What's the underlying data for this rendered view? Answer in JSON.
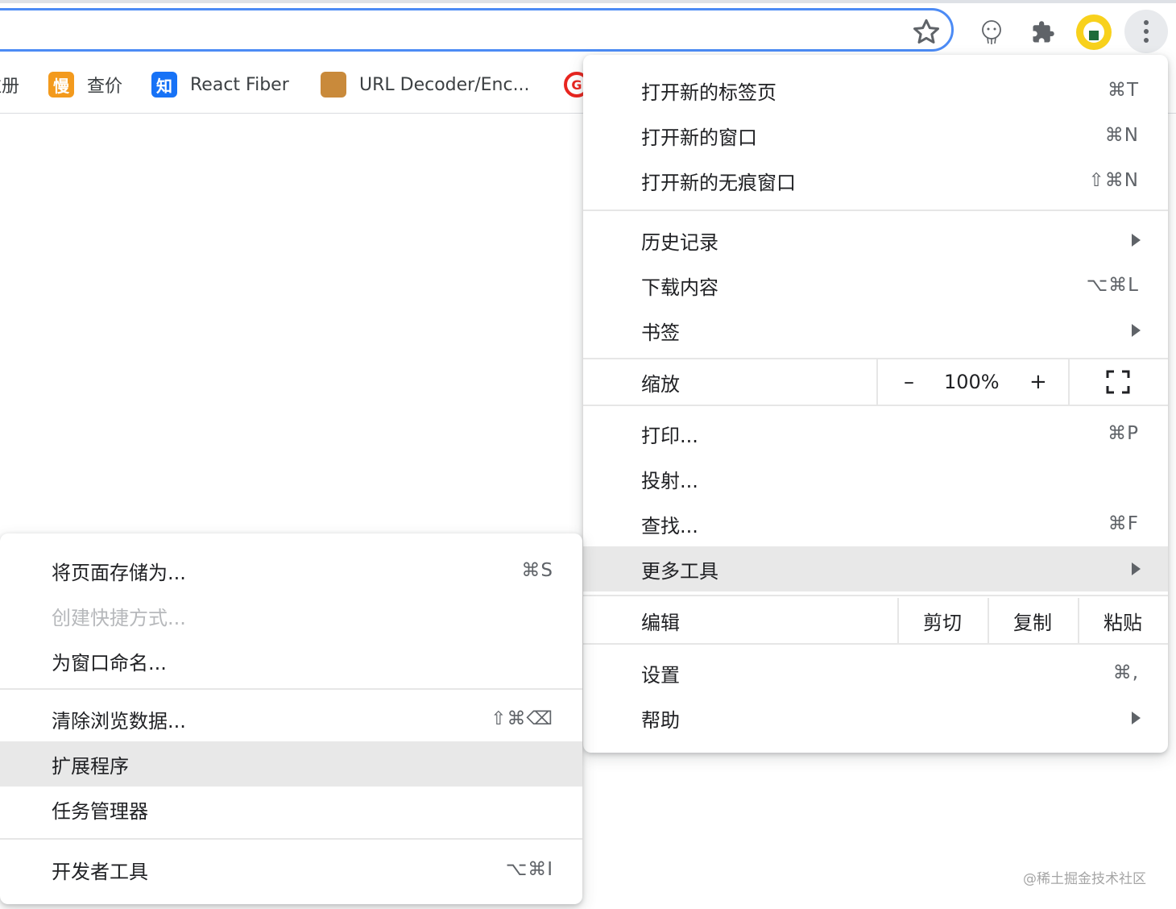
{
  "bookmarks": [
    {
      "label": "注册",
      "favicon": ""
    },
    {
      "label": "查价",
      "favicon": "慢"
    },
    {
      "label": "React Fiber",
      "favicon": "知"
    },
    {
      "label": "URL Decoder/Enc...",
      "favicon": ""
    },
    {
      "label": "",
      "favicon": "G"
    }
  ],
  "toolbar": {
    "icons": [
      "bookmark-star-icon",
      "extension-face-icon",
      "puzzle-extensions-icon",
      "profile-avatar",
      "more-menu-icon"
    ]
  },
  "main_menu": {
    "new_tab": {
      "label": "打开新的标签页",
      "shortcut": "⌘T"
    },
    "new_window": {
      "label": "打开新的窗口",
      "shortcut": "⌘N"
    },
    "new_incognito": {
      "label": "打开新的无痕窗口",
      "shortcut": "⇧⌘N"
    },
    "history": {
      "label": "历史记录"
    },
    "downloads": {
      "label": "下载内容",
      "shortcut": "⌥⌘L"
    },
    "bookmarks": {
      "label": "书签"
    },
    "zoom": {
      "label": "缩放",
      "minus": "–",
      "value": "100%",
      "plus": "+"
    },
    "print": {
      "label": "打印...",
      "shortcut": "⌘P"
    },
    "cast": {
      "label": "投射..."
    },
    "find": {
      "label": "查找...",
      "shortcut": "⌘F"
    },
    "more_tools": {
      "label": "更多工具"
    },
    "edit": {
      "label": "编辑",
      "cut": "剪切",
      "copy": "复制",
      "paste": "粘贴"
    },
    "settings": {
      "label": "设置",
      "shortcut": "⌘,"
    },
    "help": {
      "label": "帮助"
    }
  },
  "sub_menu": {
    "save_page": {
      "label": "将页面存储为...",
      "shortcut": "⌘S"
    },
    "create_shortcut": {
      "label": "创建快捷方式..."
    },
    "name_window": {
      "label": "为窗口命名..."
    },
    "clear_data": {
      "label": "清除浏览数据...",
      "shortcut": "⇧⌘⌫"
    },
    "extensions": {
      "label": "扩展程序"
    },
    "task_manager": {
      "label": "任务管理器"
    },
    "devtools": {
      "label": "开发者工具",
      "shortcut": "⌥⌘I"
    }
  },
  "watermark": "@稀土掘金技术社区",
  "colors": {
    "accent": "#4c8bf5",
    "highlight": "#e8e8e8",
    "avatar": "#f8d11c"
  }
}
